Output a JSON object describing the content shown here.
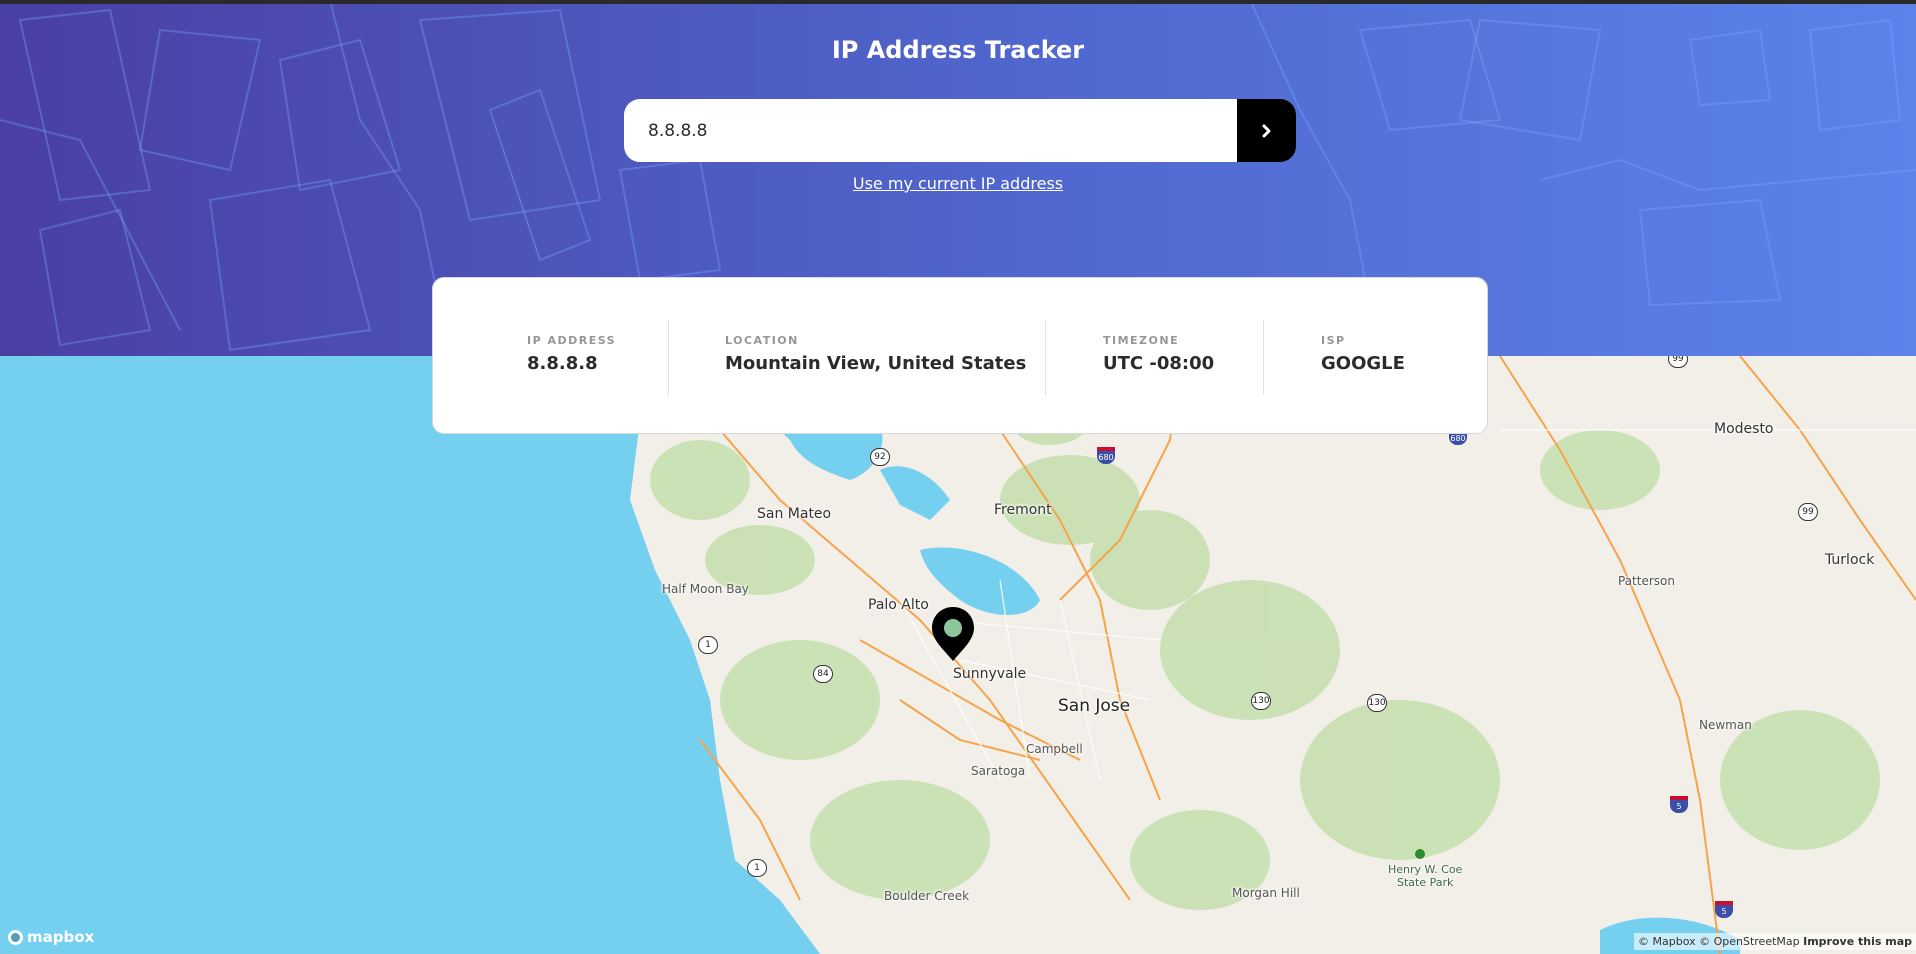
{
  "header": {
    "title": "IP Address Tracker",
    "search_value": "8.8.8.8",
    "submit_icon": "chevron-right-icon",
    "current_ip_link": "Use my current IP address"
  },
  "info": [
    {
      "label": "IP Address",
      "value": "8.8.8.8"
    },
    {
      "label": "Location",
      "value": "Mountain View, United States"
    },
    {
      "label": "Timezone",
      "value": "UTC -08:00"
    },
    {
      "label": "ISP",
      "value": "GOOGLE"
    }
  ],
  "map": {
    "marker_icon": "location-pin-icon",
    "places": {
      "san_jose": "San Jose",
      "sunnyvale": "Sunnyvale",
      "palo_alto": "Palo Alto",
      "fremont": "Fremont",
      "san_mateo": "San Mateo",
      "half_moon_bay": "Half Moon Bay",
      "campbell": "Campbell",
      "saratoga": "Saratoga",
      "boulder_creek": "Boulder Creek",
      "morgan_hill": "Morgan Hill",
      "modesto": "Modesto",
      "turlock": "Turlock",
      "patterson": "Patterson",
      "newman": "Newman",
      "park_line1": "Henry W. Coe",
      "park_line2": "State Park"
    },
    "shields": {
      "r92": "92",
      "r84": "84",
      "r1a": "1",
      "r1b": "1",
      "r130a": "130",
      "r130b": "130",
      "r99a": "99",
      "r99b": "99",
      "i680a": "680",
      "i680b": "680",
      "i5a": "5",
      "i5b": "5"
    },
    "logo": "mapbox",
    "attribution": {
      "mapbox": "© Mapbox",
      "osm": "© OpenStreetMap",
      "improve": "Improve this map"
    }
  },
  "colors": {
    "gradient_start": "#4a3fa3",
    "gradient_end": "#5b83ea",
    "water": "#75cfef",
    "land": "#f2efe9",
    "park": "#c7e0b0",
    "road": "#f5a44a"
  }
}
